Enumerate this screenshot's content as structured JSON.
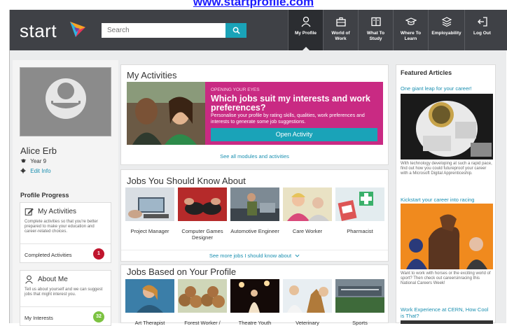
{
  "url": "www.startprofile.com",
  "header": {
    "logo": "start",
    "search_placeholder": "Search",
    "nav": [
      {
        "label": "My Profile",
        "icon": "person-icon",
        "active": true
      },
      {
        "label": "World of Work",
        "icon": "briefcase-icon",
        "active": false
      },
      {
        "label": "What To Study",
        "icon": "book-icon",
        "active": false
      },
      {
        "label": "Where To Learn",
        "icon": "graduation-cap-icon",
        "active": false
      },
      {
        "label": "Employability",
        "icon": "layers-icon",
        "active": false
      },
      {
        "label": "Log Out",
        "icon": "logout-icon",
        "active": false
      }
    ]
  },
  "profile": {
    "name": "Alice Erb",
    "year": "Year 9",
    "edit_label": "Edit Info",
    "progress_heading": "Profile Progress",
    "cards": [
      {
        "title": "My Activities",
        "icon": "pencil-icon",
        "desc": "Complete activities so that you're better prepared to make your education and career-related choices.",
        "row_label": "Completed Activities",
        "count": "1",
        "badge_color": "#c0152e"
      },
      {
        "title": "About Me",
        "icon": "person-icon",
        "desc": "Tell us about yourself and we can suggest jobs that might interest you.",
        "row_label": "My Interests",
        "count": "32",
        "badge_color": "#7cc241"
      }
    ]
  },
  "activities": {
    "heading": "My Activities",
    "kicker": "OPENING YOUR EYES",
    "title": "Which jobs suit my interests and work preferences?",
    "desc": "Personalise your profile by rating skills, qualities, work preferences and interests to generate some job suggestions.",
    "button": "Open Activity",
    "link": "See all modules and activities"
  },
  "jobs_know": {
    "heading": "Jobs You Should Know About",
    "items": [
      "Project Manager",
      "Computer Games Designer",
      "Automotive Engineer",
      "Care Worker",
      "Pharmacist"
    ],
    "link": "See more jobs I should know about"
  },
  "jobs_profile": {
    "heading": "Jobs Based on Your Profile",
    "items": [
      "Art Therapist",
      "Forest Worker /",
      "Theatre Youth",
      "Veterinary",
      "Sports"
    ]
  },
  "featured": {
    "heading": "Featured Articles",
    "articles": [
      {
        "title": "One giant leap for your career!",
        "desc": "With technology developing at such a rapid pace, find out how you could futureproof your career with a Microsoft Digital Apprenticeship."
      },
      {
        "title": "Kickstart your career into racing",
        "desc": "Want to work with horses or the exciting world of sport? Then check out careersinracing this National Careers Week!"
      },
      {
        "title": "Work Experience at CERN, How Cool is That?",
        "desc": ""
      }
    ]
  },
  "colors": {
    "topbar": "#3f4146",
    "accent": "#1aa3b8",
    "banner": "#c92a83",
    "link": "#1a8fb0"
  }
}
